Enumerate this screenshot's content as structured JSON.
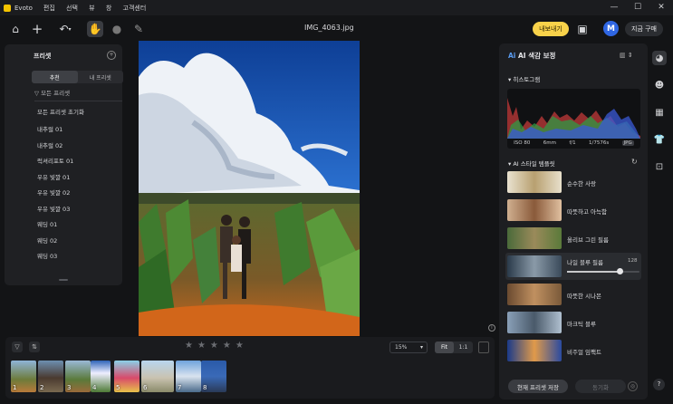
{
  "app": {
    "name": "Evoto",
    "menu": [
      "편집",
      "선택",
      "뷰",
      "창",
      "고객센터"
    ],
    "window_controls": [
      "—",
      "☐",
      "✕"
    ]
  },
  "toolbar": {
    "filename": "IMG_4063.jpg",
    "export_label": "내보내기",
    "avatar_letter": "M",
    "buy_label": "지금 구매"
  },
  "preset_panel": {
    "title": "프리셋",
    "tabs": [
      "추천",
      "내 프리셋"
    ],
    "active_tab": 0,
    "filter_label": "모든 프리셋",
    "items": [
      "모든 프리셋 초기화",
      "내추럴 01",
      "내추럴 02",
      "럭셔리포토 01",
      "우유 빛깔 01",
      "우유 빛깔 02",
      "우유 빛깔 03",
      "웨딩 01",
      "웨딩 02",
      "웨딩 03"
    ]
  },
  "filmstrip": {
    "stars": "★★★★★",
    "zoom_value": "15%",
    "fit_options": [
      "Fit",
      "1:1"
    ],
    "active_fit": 0,
    "thumb_numbers": [
      "1",
      "2",
      "3",
      "4",
      "5",
      "6",
      "7",
      "8"
    ]
  },
  "right_panel": {
    "title": "AI 색감 보정",
    "histogram_title": "히스토그램",
    "exif": [
      "ISO 80",
      "6mm",
      "f/1",
      "1/7576s",
      "JPG"
    ],
    "style_title": "AI 스타일 템플릿",
    "styles": [
      "순수한 사랑",
      "따뜻하고 아늑함",
      "올리브 그린 필름",
      "나일 블루 필름",
      "따뜻한 시나몬",
      "마크틱 블루",
      "비주얼 임팩트"
    ],
    "active_style": 3,
    "active_style_value": "128",
    "active_style_level": 0.72,
    "save_preset_label": "현재 프리셋 저장",
    "sync_label": "동기화"
  },
  "colors": {
    "accent_yellow": "#f8d24a",
    "avatar_blue": "#2f66e3",
    "panel_bg": "#1f2023"
  }
}
